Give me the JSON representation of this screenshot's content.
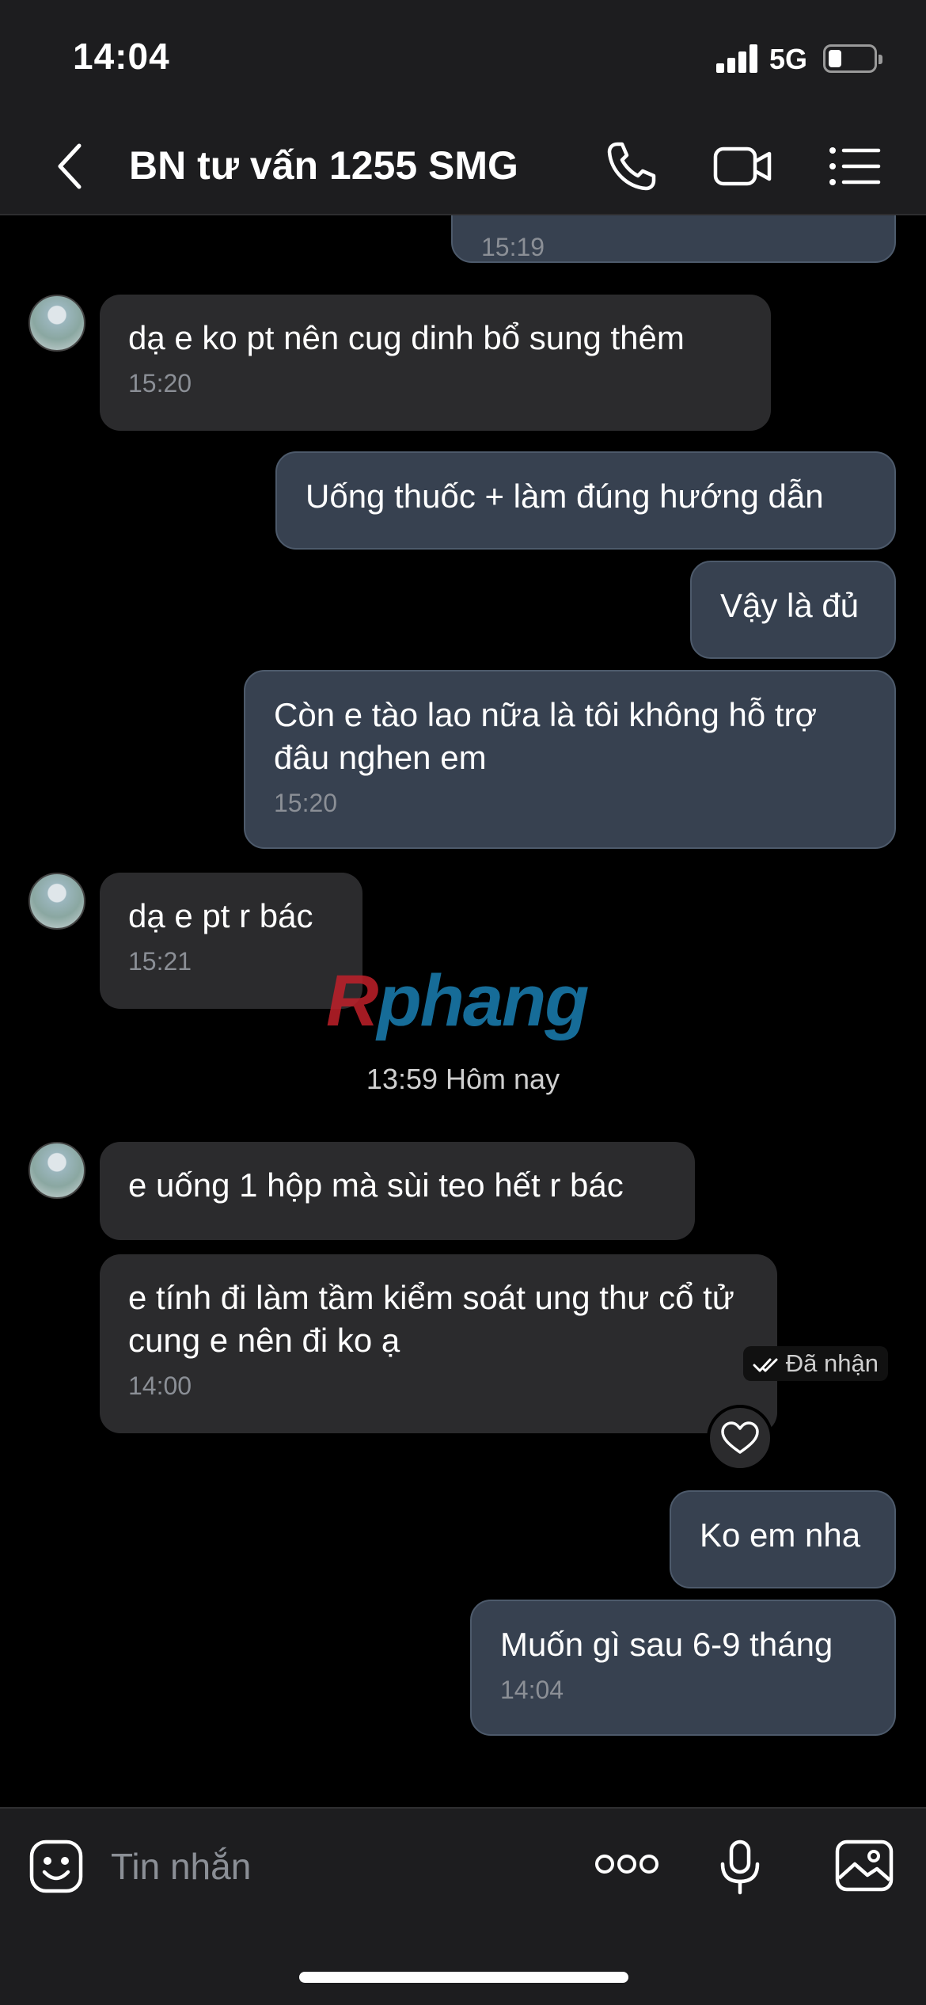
{
  "status": {
    "time": "14:04",
    "network": "5G",
    "battery_level": 0.3
  },
  "header": {
    "title": "BN tư vấn 1255 SMG"
  },
  "messages": [
    {
      "side": "out",
      "time": "15:19"
    },
    {
      "side": "in",
      "text": "dạ e ko pt nên cug dinh bổ sung thêm",
      "time": "15:20"
    },
    {
      "side": "out",
      "text": "Uống thuốc + làm đúng hướng dẫn"
    },
    {
      "side": "out",
      "text": "Vậy là đủ"
    },
    {
      "side": "out",
      "text": "Còn e tào lao nữa là tôi không hỗ trợ đâu nghen em",
      "time": "15:20"
    },
    {
      "side": "in",
      "text": "dạ e pt r bác",
      "time": "15:21"
    },
    {
      "side": "in",
      "text": "e uống 1 hộp mà sùi teo hết r bác"
    },
    {
      "side": "in",
      "text": "e tính đi làm tầm kiểm soát ung thư cổ tử cung e nên đi ko ạ",
      "time": "14:00"
    },
    {
      "side": "out",
      "text": "Ko em nha"
    },
    {
      "side": "out",
      "text": "Muốn gì sau 6-9 tháng",
      "time": "14:04"
    }
  ],
  "date_separator": "13:59 Hôm nay",
  "watermark": {
    "part1": "R",
    "part2": "phang"
  },
  "receipt": "Đã nhận",
  "input": {
    "placeholder": "Tin nhắn"
  },
  "colors": {
    "incoming_bubble": "#2b2b2d",
    "outgoing_bubble": "#374150",
    "background": "#000000",
    "bar": "#1d1d1f"
  },
  "icons": [
    "back-arrow-icon",
    "phone-icon",
    "video-icon",
    "menu-list-icon",
    "heart-icon",
    "double-check-icon",
    "sticker-icon",
    "more-icon",
    "microphone-icon",
    "gallery-icon"
  ]
}
